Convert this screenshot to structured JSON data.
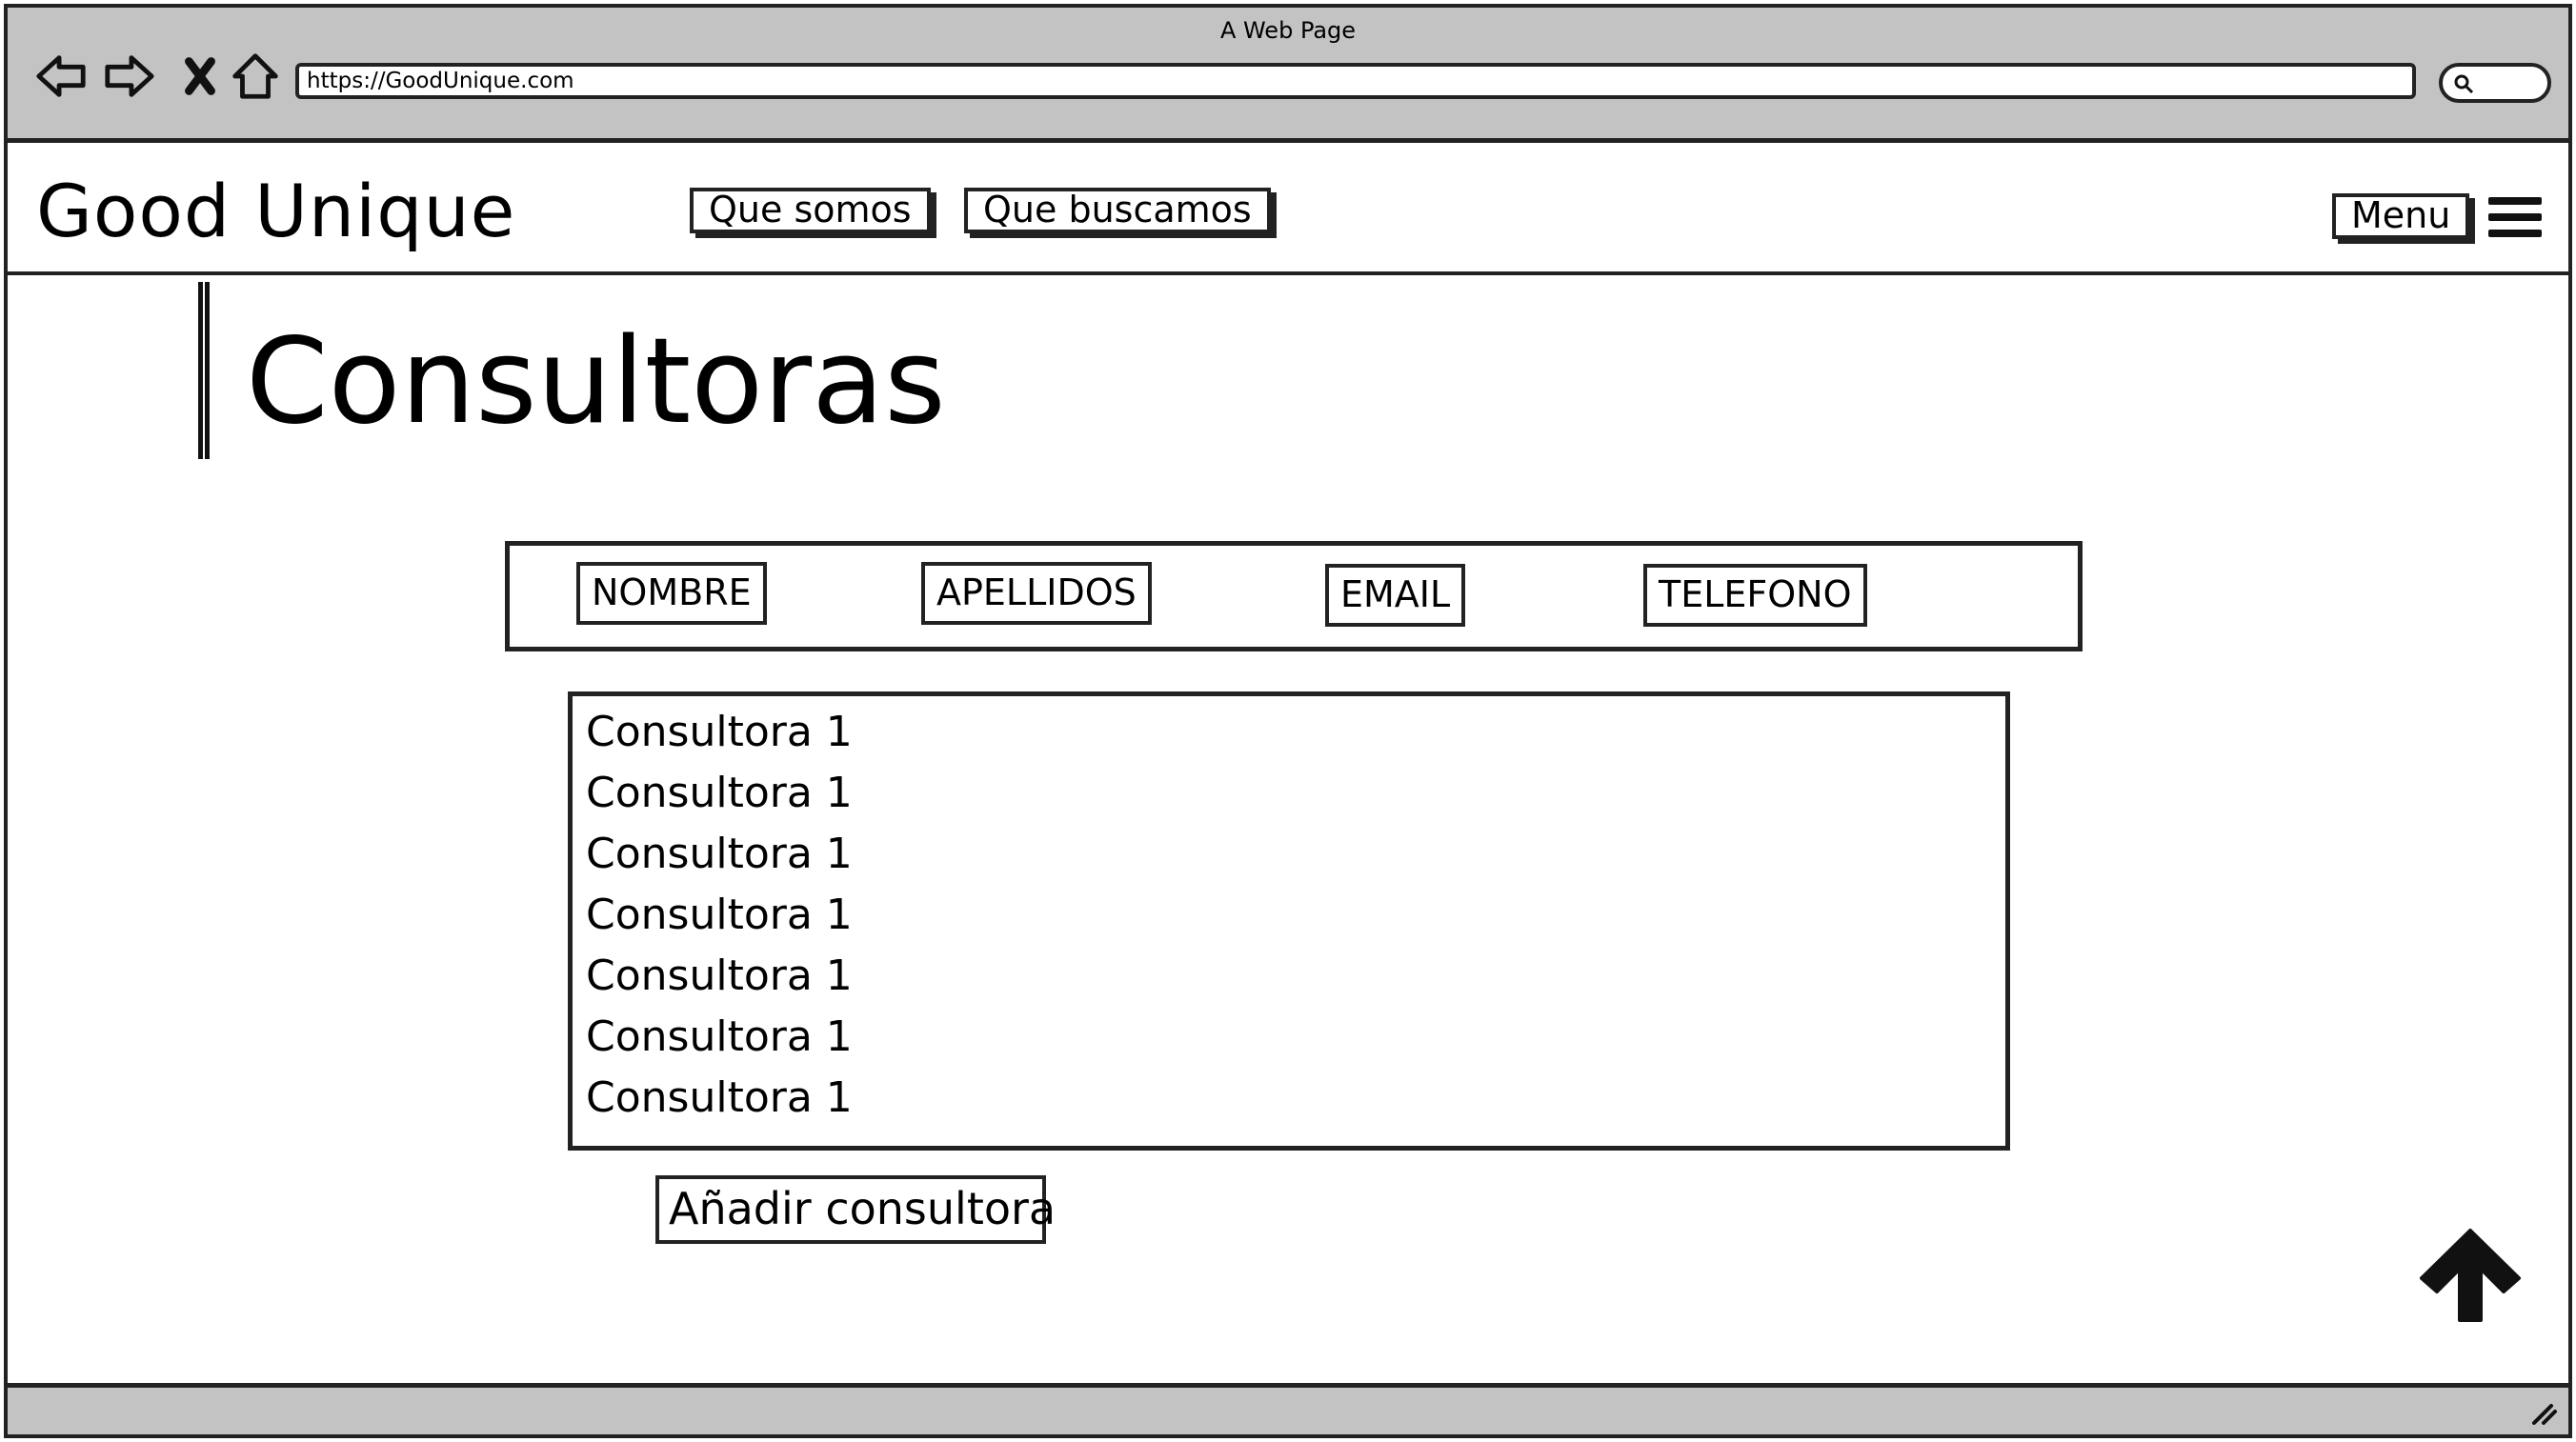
{
  "browser": {
    "window_title": "A Web Page",
    "url": "https://GoodUnique.com",
    "nav_icons": [
      "back-arrow-icon",
      "forward-arrow-icon",
      "stop-icon",
      "home-icon"
    ],
    "search_icon": "search-icon"
  },
  "header": {
    "brand": "Good Unique",
    "nav": [
      {
        "label": "Que somos"
      },
      {
        "label": "Que buscamos"
      }
    ],
    "menu_label": "Menu",
    "menu_icon": "hamburger-icon"
  },
  "page": {
    "title": "Consultoras",
    "filters": [
      {
        "label": "NOMBRE"
      },
      {
        "label": "APELLIDOS"
      },
      {
        "label": "EMAIL"
      },
      {
        "label": "TELEFONO"
      }
    ],
    "list": [
      "Consultora 1",
      "Consultora 1",
      "Consultora 1",
      "Consultora 1",
      "Consultora 1",
      "Consultora 1",
      "Consultora 1"
    ],
    "add_button": "Añadir consultora",
    "scroll_top_icon": "up-arrow-icon"
  }
}
